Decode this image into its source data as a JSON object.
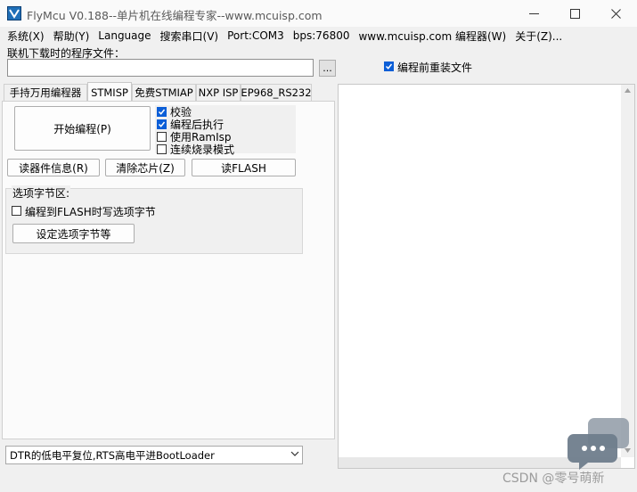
{
  "window": {
    "title": "FlyMcu V0.188--单片机在线编程专家--www.mcuisp.com",
    "controls": [
      "minimize",
      "maximize",
      "close"
    ]
  },
  "menu": {
    "items": [
      "系统(X)",
      "帮助(Y)",
      "Language",
      "搜索串口(V)",
      "Port:COM3",
      "bps:76800",
      "www.mcuisp.com 编程器(W)",
      "关于(Z)..."
    ]
  },
  "file": {
    "label": "联机下载时的程序文件：",
    "value": "",
    "browse_label": "...",
    "reload_label": "编程前重装文件",
    "reload_checked": true
  },
  "tabs": [
    "手持万用编程器",
    "STMISP",
    "免费STMIAP",
    "NXP ISP",
    "EP968_RS232"
  ],
  "active_tab": "STMISP",
  "stmisp": {
    "start_button": "开始编程(P)",
    "options": [
      {
        "label": "校验",
        "checked": true
      },
      {
        "label": "编程后执行",
        "checked": true
      },
      {
        "label": "使用RamIsp",
        "checked": false
      },
      {
        "label": "连续烧录模式",
        "checked": false
      }
    ],
    "read_info_button": "读器件信息(R)",
    "erase_button": "清除芯片(Z)",
    "read_flash_button": "读FLASH",
    "option_group": {
      "title": "选项字节区:",
      "write_option_label": "编程到FLASH时写选项字节",
      "write_option_checked": false,
      "set_button": "设定选项字节等"
    }
  },
  "reset_mode": {
    "selected": "DTR的低电平复位,RTS高电平进BootLoader"
  },
  "watermark": "CSDN @零号萌新",
  "colors": {
    "accent": "#0b5ed7",
    "window_bg": "#f0f0f0",
    "log_bg": "#ffffff"
  },
  "icons": {
    "app": "flymcu-logo-icon",
    "close": "close-icon",
    "minimize": "minimize-icon",
    "maximize": "maximize-icon",
    "dropdown": "chevron-down-icon",
    "chat": "chat-bubble-icon"
  }
}
